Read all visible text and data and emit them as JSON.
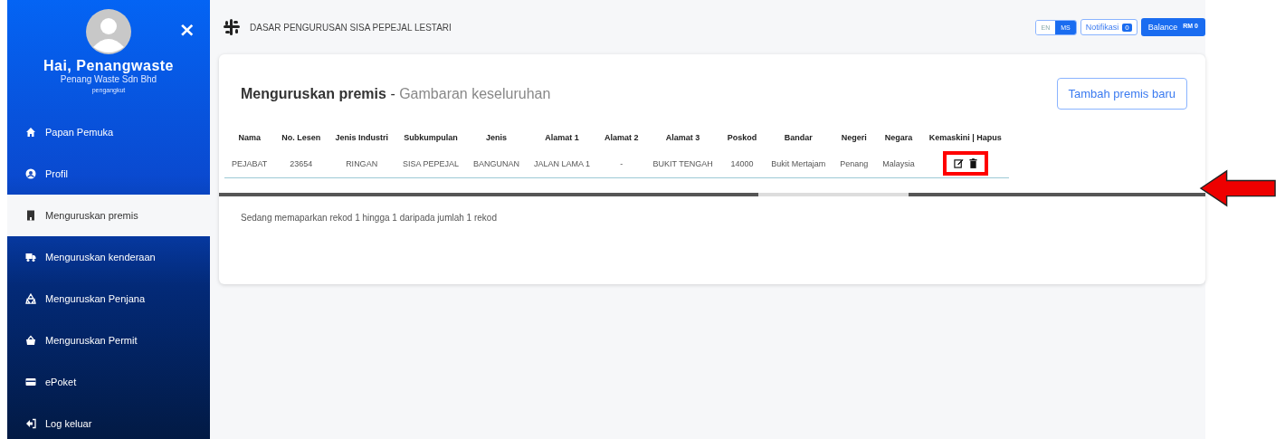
{
  "sidebar": {
    "close": "×",
    "greeting": "Hai, Penangwaste",
    "company": "Penang Waste Sdn Bhd",
    "role": "pengangkut",
    "items": [
      {
        "label": "Papan Pemuka",
        "kind": "home",
        "selected": false
      },
      {
        "label": "Profil",
        "kind": "user",
        "selected": false
      },
      {
        "label": "Menguruskan premis",
        "kind": "building",
        "selected": true
      },
      {
        "label": "Menguruskan kenderaan",
        "kind": "truck",
        "selected": false
      },
      {
        "label": "Menguruskan Penjana",
        "kind": "recycle",
        "selected": false
      },
      {
        "label": "Menguruskan Permit",
        "kind": "basket",
        "selected": false
      },
      {
        "label": "ePoket",
        "kind": "card",
        "selected": false
      },
      {
        "label": "Log keluar",
        "kind": "exit",
        "selected": false
      }
    ]
  },
  "header": {
    "title": "DASAR PENGURUSAN SISA PEPEJAL LESTARI",
    "languages": [
      {
        "label": "EN",
        "selected": false
      },
      {
        "label": "MS",
        "selected": true
      }
    ],
    "notification": {
      "label": "Notifikasi",
      "count": "0"
    },
    "balance": {
      "label": "Balance",
      "amount": "RM 0"
    }
  },
  "card": {
    "title": "Menguruskan premis",
    "separator": "-",
    "subtitle": "Gambaran keseluruhan",
    "add_button": "Tambah premis baru",
    "columns": [
      "Nama",
      "No. Lesen",
      "Jenis Industri",
      "Subkumpulan",
      "Jenis",
      "Alamat 1",
      "Alamat 2",
      "Alamat 3",
      "Poskod",
      "Bandar",
      "Negeri",
      "Negara",
      "Kemaskini | Hapus"
    ],
    "rows": [
      [
        "PEJABAT",
        "23654",
        "RINGAN",
        "SISA PEPEJAL",
        "BANGUNAN",
        "JALAN LAMA 1",
        "-",
        "BUKIT TENGAH",
        "14000",
        "Bukit Mertajam",
        "Penang",
        "Malaysia"
      ]
    ],
    "footer": "Sedang memaparkan rekod 1 hingga 1 daripada jumlah 1 rekod"
  }
}
